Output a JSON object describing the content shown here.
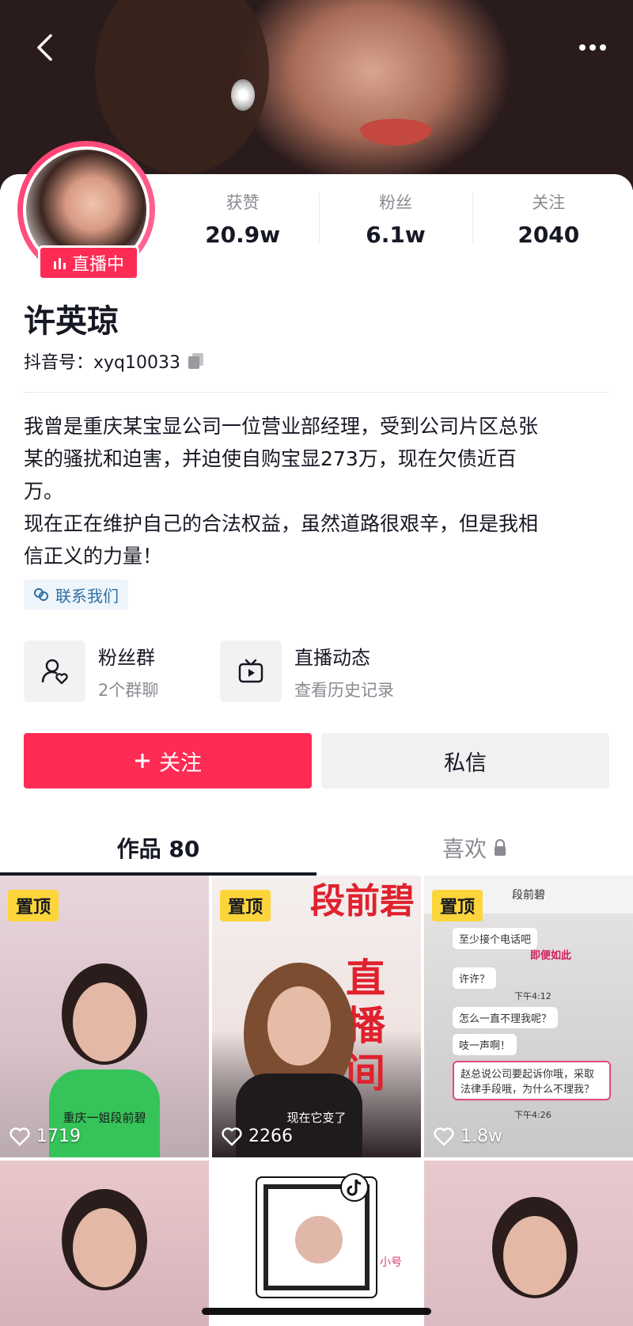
{
  "profile": {
    "name": "许英琼",
    "douyin_id": "抖音号：xyq10033",
    "live_badge": "直播中",
    "bio": "我曾是重庆某宝显公司一位营业部经理，受到公司片区总张\n某的骚扰和迫害，并迫使自购宝显273万，现在欠债近百\n万。\n现在正在维护自己的合法权益，虽然道路很艰辛，但是我相\n信正义的力量！",
    "contact_tag": "联系我们"
  },
  "stats": [
    {
      "label": "获赞",
      "value": "20.9w"
    },
    {
      "label": "粉丝",
      "value": "6.1w"
    },
    {
      "label": "关注",
      "value": "2040"
    }
  ],
  "features": [
    {
      "title": "粉丝群",
      "subtitle": "2个群聊",
      "icon": "fan-group-icon"
    },
    {
      "title": "直播动态",
      "subtitle": "查看历史记录",
      "icon": "live-tv-icon"
    }
  ],
  "actions": {
    "follow": "关注",
    "message": "私信"
  },
  "tabs": {
    "works": "作品 80",
    "likes": "喜欢"
  },
  "grid": {
    "pinned_label": "置顶",
    "items": [
      {
        "likes": "1719",
        "caption": "重庆一姐段前碧",
        "pinned": true
      },
      {
        "likes": "2266",
        "caption": "现在它变了",
        "pinned": true,
        "overlay": "段前碧",
        "overlay2": "直播间"
      },
      {
        "likes": "1.8w",
        "pinned": true,
        "chat_title": "段前碧",
        "chat_lines": [
          "至少接个电话吧",
          "即便如此",
          "许许？",
          "下午4:12",
          "怎么一直不理我呢？",
          "吱一声啊！",
          "赵总说公司要起诉你哦，采取法律手段哦，为什么不理我？",
          "下午4:26"
        ]
      },
      {},
      {
        "tag": "小号"
      },
      {}
    ]
  },
  "colors": {
    "accent": "#fe2c55",
    "pin": "#fcd53b",
    "link": "#2f6ea3"
  }
}
